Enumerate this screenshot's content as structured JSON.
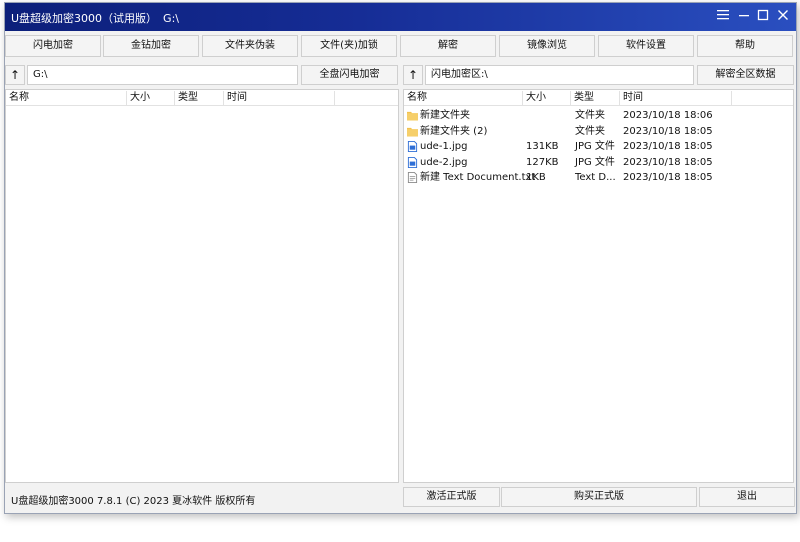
{
  "window": {
    "title": "U盘超级加密3000（试用版）",
    "path": "G:\\"
  },
  "toolbar": {
    "buttons": [
      "闪电加密",
      "金钻加密",
      "文件夹伪装",
      "文件(夹)加锁",
      "解密",
      "镜像浏览",
      "软件设置",
      "帮助"
    ]
  },
  "left_pane": {
    "up_glyph": "↑",
    "path": "G:\\",
    "action_label": "全盘闪电加密",
    "columns": [
      "名称",
      "大小",
      "类型",
      "时间"
    ]
  },
  "right_pane": {
    "up_glyph": "↑",
    "path": "闪电加密区:\\",
    "action_label": "解密全区数据",
    "columns": [
      "名称",
      "大小",
      "类型",
      "时间"
    ],
    "files": [
      {
        "icon": "folder-icon",
        "name": "新建文件夹",
        "size": "",
        "type": "文件夹",
        "time": "2023/10/18 18:06"
      },
      {
        "icon": "folder-icon",
        "name": "新建文件夹 (2)",
        "size": "",
        "type": "文件夹",
        "time": "2023/10/18 18:05"
      },
      {
        "icon": "image-file-icon",
        "name": "ude-1.jpg",
        "size": "131KB",
        "type": "JPG 文件",
        "time": "2023/10/18 18:05"
      },
      {
        "icon": "image-file-icon",
        "name": "ude-2.jpg",
        "size": "127KB",
        "type": "JPG 文件",
        "time": "2023/10/18 18:05"
      },
      {
        "icon": "text-file-icon",
        "name": "新建 Text Document.txt",
        "size": "1KB",
        "type": "Text D...",
        "time": "2023/10/18 18:05"
      }
    ]
  },
  "statusbar": {
    "text": "U盘超级加密3000 7.8.1 (C) 2023 夏冰软件 版权所有",
    "activate_label": "激活正式版",
    "buy_label": "购买正式版",
    "exit_label": "退出"
  },
  "colors": {
    "titlebar": "#162d96",
    "folder": "#f2c14e",
    "file_blue": "#2f6fd6"
  }
}
